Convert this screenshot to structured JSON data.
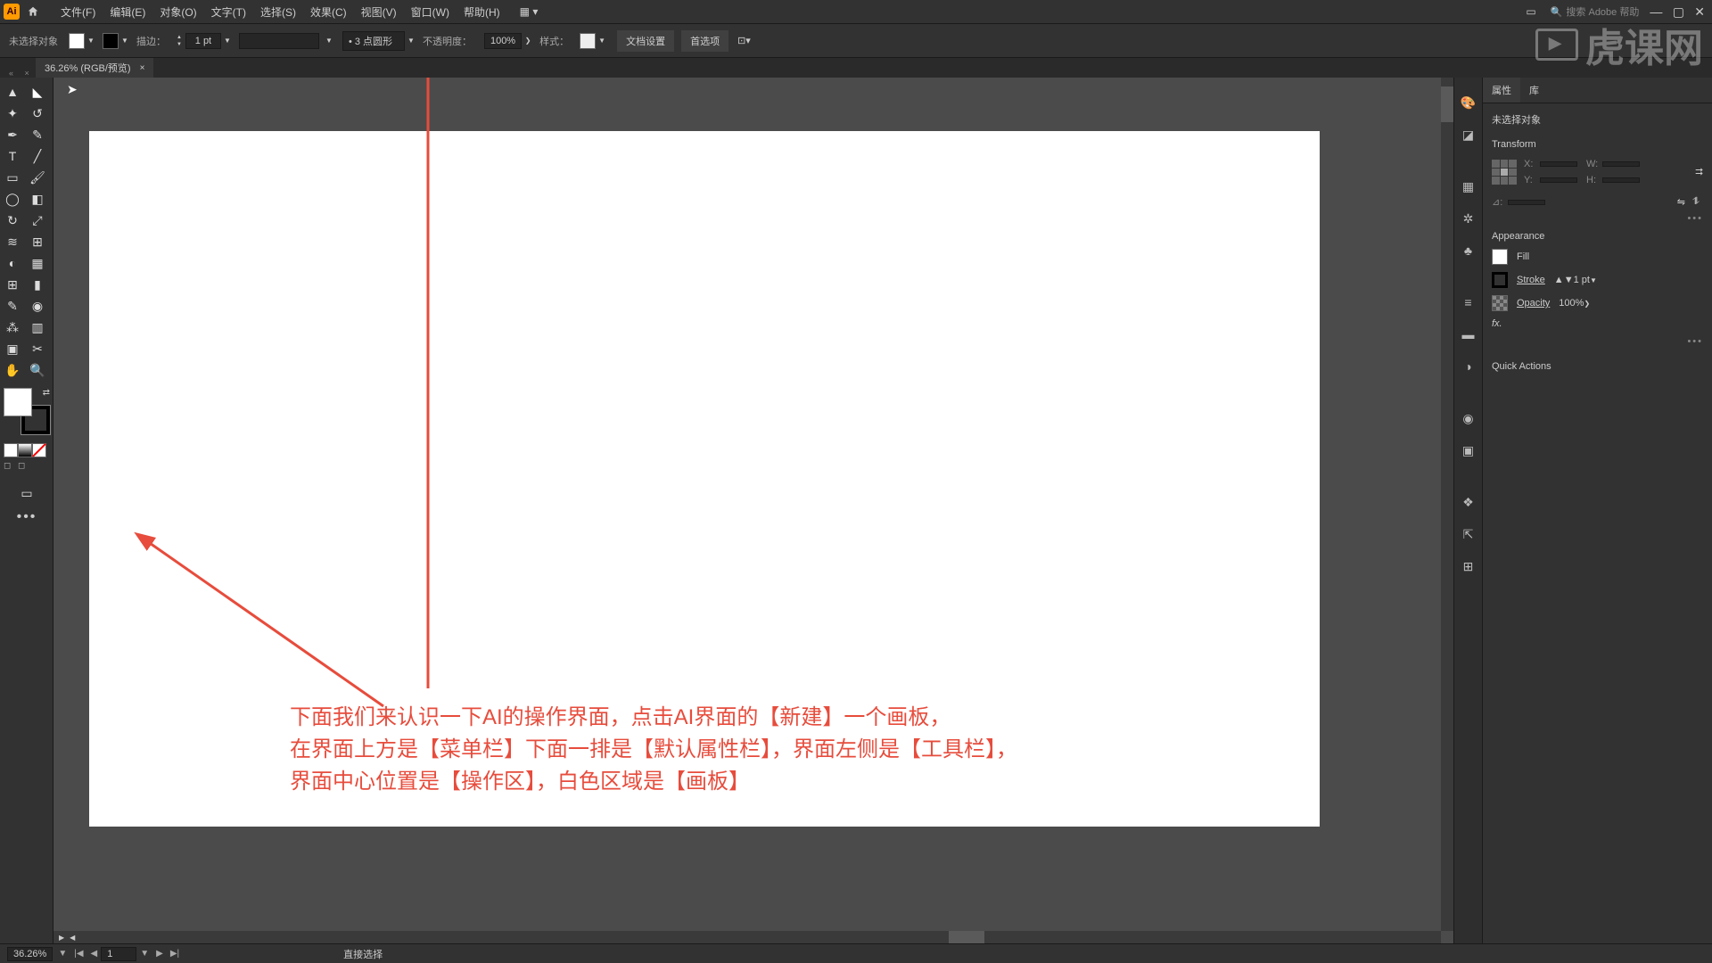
{
  "menubar": {
    "items": [
      "文件(F)",
      "编辑(E)",
      "对象(O)",
      "文字(T)",
      "选择(S)",
      "效果(C)",
      "视图(V)",
      "窗口(W)",
      "帮助(H)"
    ],
    "search_placeholder": "搜索 Adobe 帮助"
  },
  "controlbar": {
    "no_selection": "未选择对象",
    "stroke_label": "描边：",
    "stroke_value": "1 pt",
    "dash_label": "3 点圆形",
    "opacity_label": "不透明度：",
    "opacity_value": "100%",
    "style_label": "样式：",
    "doc_setup": "文档设置",
    "prefs": "首选项"
  },
  "doctab": {
    "label": "36.26% (RGB/预览)"
  },
  "annotation": {
    "line1": "下面我们来认识一下AI的操作界面，点击AI界面的【新建】一个画板，",
    "line2": "在界面上方是【菜单栏】下面一排是【默认属性栏】，界面左侧是【工具栏】，",
    "line3": "界面中心位置是【操作区】，白色区域是【画板】"
  },
  "props": {
    "tab_props": "属性",
    "tab_lib": "库",
    "no_sel": "未选择对象",
    "transform": "Transform",
    "x_label": "X:",
    "w_label": "W:",
    "y_label": "Y:",
    "h_label": "H:",
    "angle_label": "⊿:",
    "appearance": "Appearance",
    "fill": "Fill",
    "stroke": "Stroke",
    "stroke_val": "1 pt",
    "opacity": "Opacity",
    "opacity_val": "100%",
    "fx": "fx.",
    "quick": "Quick Actions"
  },
  "statusbar": {
    "zoom": "36.26%",
    "page": "1",
    "tool_hint": "直接选择"
  },
  "watermark": "虎课网"
}
